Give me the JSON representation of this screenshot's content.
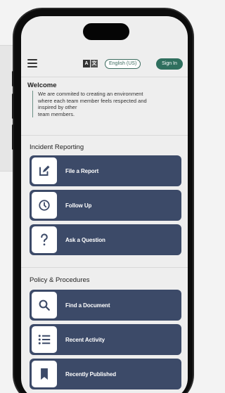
{
  "topbar": {
    "menu_icon": "hamburger-icon",
    "translate_icon": "translate-icon",
    "translate_glyphs": [
      "A",
      "文"
    ],
    "language": "English (US)",
    "sign_in": "Sign In"
  },
  "welcome": {
    "title": "Welcome",
    "lines": [
      "We are commited to creating an environment",
      "where each team member feels respected and",
      "inspired by other",
      "team members."
    ]
  },
  "incident": {
    "title": "Incident Reporting",
    "items": [
      {
        "label": "File a Report",
        "icon": "edit-icon"
      },
      {
        "label": "Follow Up",
        "icon": "clock-icon"
      },
      {
        "label": "Ask a Question",
        "icon": "question-icon"
      }
    ]
  },
  "policy": {
    "title": "Policy & Procedures",
    "items": [
      {
        "label": "Find a Document",
        "icon": "search-icon"
      },
      {
        "label": "Recent Activity",
        "icon": "list-icon"
      },
      {
        "label": "Recently Published",
        "icon": "bookmark-icon"
      }
    ]
  },
  "colors": {
    "tile": "#3c4a68",
    "accent": "#2f6f5e",
    "background": "#eeeeee"
  }
}
